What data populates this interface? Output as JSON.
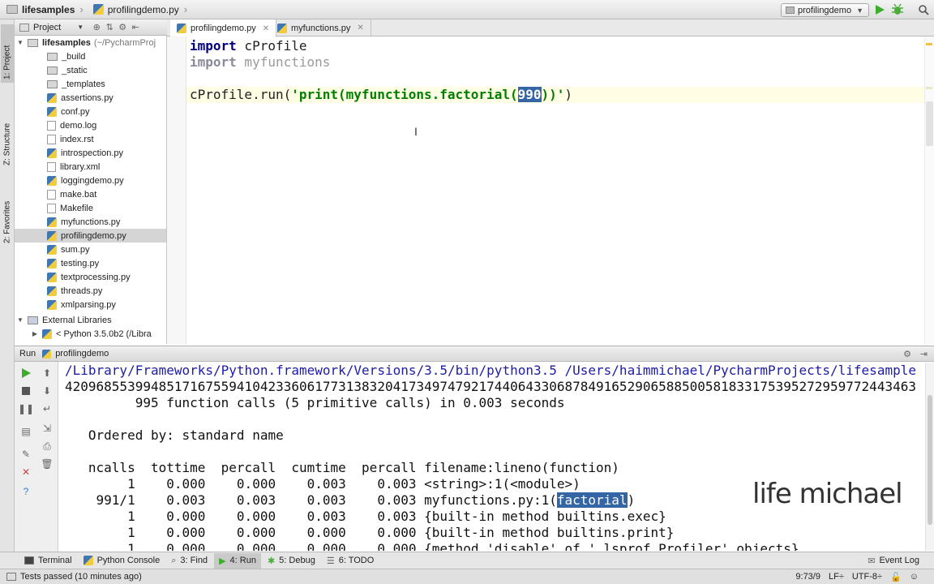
{
  "navbar": {
    "project": "lifesamples",
    "file": "profilingdemo.py",
    "run_config": "profilingdemo"
  },
  "left_strip": {
    "tabs": [
      "1: Project",
      "Z: Structure",
      "2: Favorites"
    ]
  },
  "project_panel": {
    "title": "Project",
    "root": {
      "name": "lifesamples",
      "path": "(~/PycharmProj"
    },
    "items": [
      {
        "name": "_build",
        "kind": "folder"
      },
      {
        "name": "_static",
        "kind": "folder"
      },
      {
        "name": "_templates",
        "kind": "folder"
      },
      {
        "name": "assertions.py",
        "kind": "py"
      },
      {
        "name": "conf.py",
        "kind": "py"
      },
      {
        "name": "demo.log",
        "kind": "file"
      },
      {
        "name": "index.rst",
        "kind": "file"
      },
      {
        "name": "introspection.py",
        "kind": "py"
      },
      {
        "name": "library.xml",
        "kind": "file"
      },
      {
        "name": "loggingdemo.py",
        "kind": "py"
      },
      {
        "name": "make.bat",
        "kind": "file"
      },
      {
        "name": "Makefile",
        "kind": "file"
      },
      {
        "name": "myfunctions.py",
        "kind": "py"
      },
      {
        "name": "profilingdemo.py",
        "kind": "py"
      },
      {
        "name": "sum.py",
        "kind": "py"
      },
      {
        "name": "testing.py",
        "kind": "py"
      },
      {
        "name": "textprocessing.py",
        "kind": "py"
      },
      {
        "name": "threads.py",
        "kind": "py"
      },
      {
        "name": "xmlparsing.py",
        "kind": "py"
      }
    ],
    "external": "External Libraries",
    "python": "< Python 3.5.0b2 (/Libra"
  },
  "editor": {
    "tabs": [
      "profilingdemo.py",
      "myfunctions.py"
    ],
    "code": {
      "l1_kw": "import",
      "l1_rest": " cProfile",
      "l2_kw": "import",
      "l2_rest": " myfunctions",
      "l4_call": "cProfile.run(",
      "l4_str_a": "'print(myfunctions.factorial(",
      "l4_sel": "990",
      "l4_str_b": "))'",
      "l4_end": ")"
    }
  },
  "run_panel": {
    "label": "Run",
    "config": "profilingdemo",
    "console": {
      "cmd": "/Library/Frameworks/Python.framework/Versions/3.5/bin/python3.5 /Users/haimmichael/PycharmProjects/lifesample",
      "number": "4209685539948517167559410423360617731383204173497479217440643306878491652906588500581833175395272959772443463",
      "summary": "         995 function calls (5 primitive calls) in 0.003 seconds",
      "ordered": "   Ordered by: standard name",
      "header": "   ncalls  tottime  percall  cumtime  percall filename:lineno(function)",
      "row1": "        1    0.000    0.000    0.003    0.003 <string>:1(<module>)",
      "row2_pre": "    991/1    0.003    0.003    0.003    0.003 myfunctions.py:1(",
      "row2_sel": "factorial",
      "row2_post": ")",
      "row3": "        1    0.000    0.000    0.003    0.003 {built-in method builtins.exec}",
      "row4": "        1    0.000    0.000    0.000    0.000 {built-in method builtins.print}",
      "row5": "        1    0.000    0.000    0.000    0.000 {method 'disable' of '_lsprof.Profiler' objects}"
    }
  },
  "watermark": "life michael",
  "tool_buttons": [
    {
      "label": "Terminal"
    },
    {
      "label": "Python Console"
    },
    {
      "label": "3: Find"
    },
    {
      "label": "4: Run"
    },
    {
      "label": "5: Debug"
    },
    {
      "label": "6: TODO"
    }
  ],
  "event_log": "Event Log",
  "status": {
    "message": "Tests passed (10 minutes ago)",
    "position": "9:73/9",
    "line_sep": "LF÷",
    "encoding": "UTF-8÷"
  }
}
